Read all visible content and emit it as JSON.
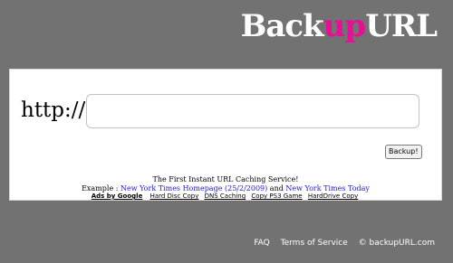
{
  "logo": {
    "part1": "Backup",
    "part1_plain": "Back",
    "accent": "up",
    "part2": "URL",
    "accent_color": "#e60f96"
  },
  "form": {
    "protocol_label": "http://",
    "url_value": "",
    "url_placeholder": "",
    "submit_label": "Backup!"
  },
  "tagline": "The First Instant URL Caching Service!",
  "example": {
    "prefix": "Example : ",
    "link1": "New York Times Homepage (25/2/2009)",
    "middle": " and ",
    "link2": "New York Times Today"
  },
  "ads": {
    "label": "Ads by Google",
    "links": [
      "Hard Disc Copy",
      "DNS Caching",
      "Copy PS3 Game",
      "HardDrive Copy"
    ]
  },
  "footer": {
    "faq": "FAQ",
    "terms": "Terms of Service",
    "copyright": "© backupURL.com"
  }
}
